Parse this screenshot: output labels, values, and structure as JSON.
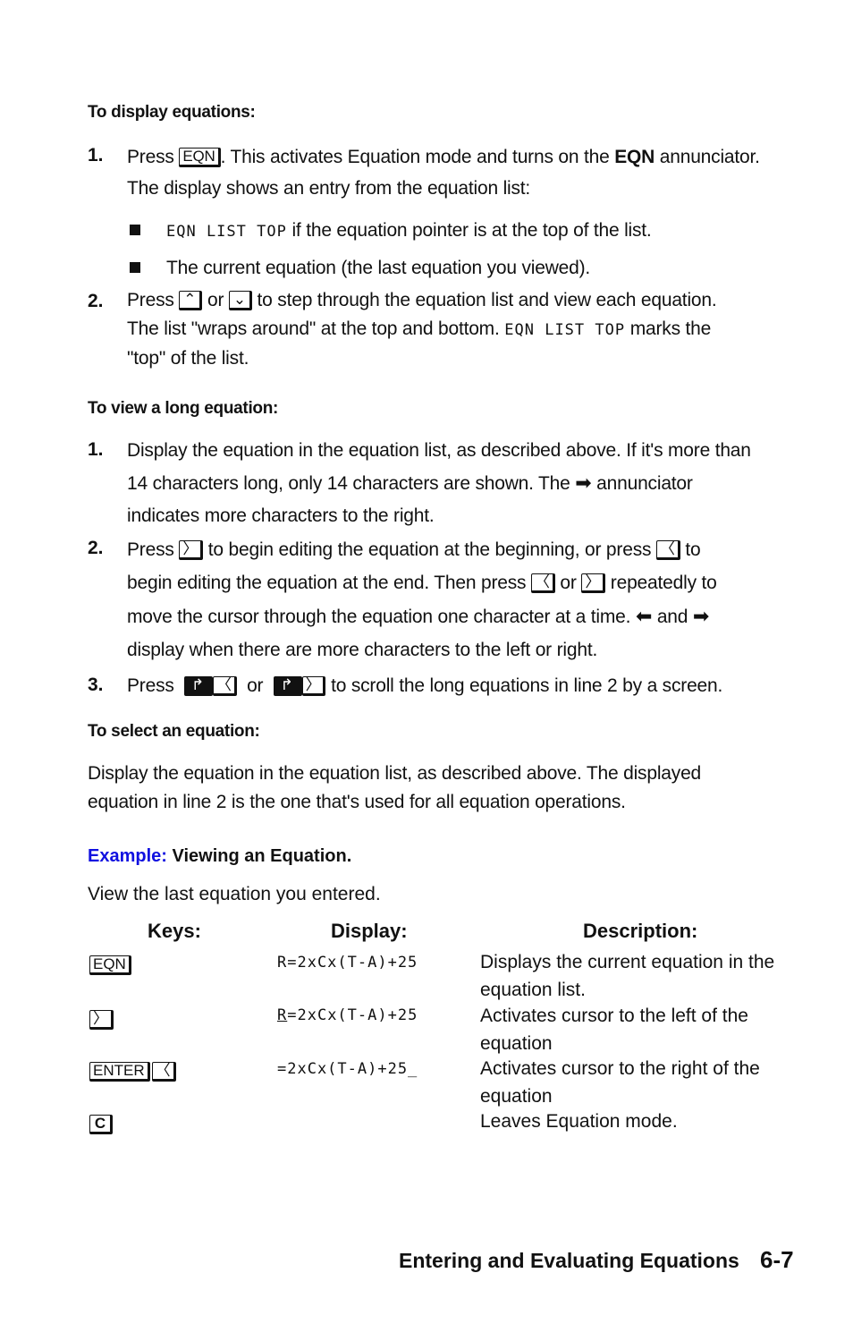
{
  "sections": {
    "display": {
      "heading": "To display equations:",
      "step1": {
        "num": "1.",
        "pre": "Press",
        "key": "EQN",
        "mid": ". This activates Equation mode and turns on the",
        "annunciator": "EQN",
        "post": "annunciator.",
        "line2": "The display shows an entry from the equation list:"
      },
      "bullets": [
        {
          "lcd": "EQN LIST TOP",
          "text": "if the equation pointer is at the top of the list."
        },
        {
          "text": "The current equation (the last equation you viewed)."
        }
      ],
      "step2": {
        "num": "2.",
        "pre": "Press",
        "key_up": "^",
        "or": "or",
        "key_down": "v",
        "post": "to step through the equation list and view each equation.",
        "line2_pre": "The list \"wraps around\" at the top and bottom.",
        "lcd": "EQN LIST TOP",
        "line2_post": "marks the",
        "line3": "\"top\" of the list."
      }
    },
    "long": {
      "heading": "To view a long equation:",
      "step1": {
        "num": "1.",
        "line1": "Display the equation in the equation list, as described above. If it's more than",
        "line2_pre": "14 characters long, only 14 characters are shown. The",
        "arrow_right": "➡",
        "line2_post": "annunciator",
        "line3": "indicates more characters to the right."
      },
      "step2": {
        "num": "2.",
        "pre": "Press",
        "key_right": ">",
        "mid1": "to begin editing the equation at the beginning, or press",
        "key_left": "<",
        "mid2": "to",
        "line2_pre": "begin editing the equation at the end. Then press",
        "or": "or",
        "line2_post": "repeatedly to",
        "line3_pre": "move the cursor through the equation one character at a time.",
        "arrow_left": "⬅",
        "and": "and",
        "arrow_right": "➡",
        "line4": "display when there are more characters to the left or right."
      },
      "step3": {
        "num": "3.",
        "pre": "Press",
        "shift_key": "↱",
        "key_left": "<",
        "or": "or",
        "key_right": ">",
        "post": "to scroll the long equations in line 2 by a screen."
      }
    },
    "select": {
      "heading": "To select an equation:",
      "line1": "Display the equation in the equation list, as described above. The displayed",
      "line2": "equation in line 2 is the one that's used for all equation operations."
    }
  },
  "example": {
    "label": "Example:",
    "title": "Viewing an Equation.",
    "intro": "View the last equation you entered.",
    "columns": {
      "keys": "Keys:",
      "display": "Display:",
      "description": "Description:"
    },
    "rows": [
      {
        "keys": [
          "EQN"
        ],
        "display_cursor": "",
        "display": "R=2xCx(T-A)+25",
        "description": "Displays the current equation in the equation list."
      },
      {
        "keys": [
          ">"
        ],
        "display_cursor": "R",
        "display": "=2xCx(T-A)+25",
        "description": "Activates cursor to the left of the equation"
      },
      {
        "keys": [
          "ENTER",
          "<"
        ],
        "display_cursor": "",
        "display": "=2xCx(T-A)+25_",
        "description": "Activates cursor to the right of the equation"
      },
      {
        "keys": [
          "C"
        ],
        "display_cursor": "",
        "display": "",
        "description": "Leaves Equation mode."
      }
    ]
  },
  "footer": {
    "chapter": "Entering and Evaluating Equations",
    "page": "6-7"
  },
  "colors": {
    "example_label": "#1010e0",
    "text": "#111111"
  }
}
